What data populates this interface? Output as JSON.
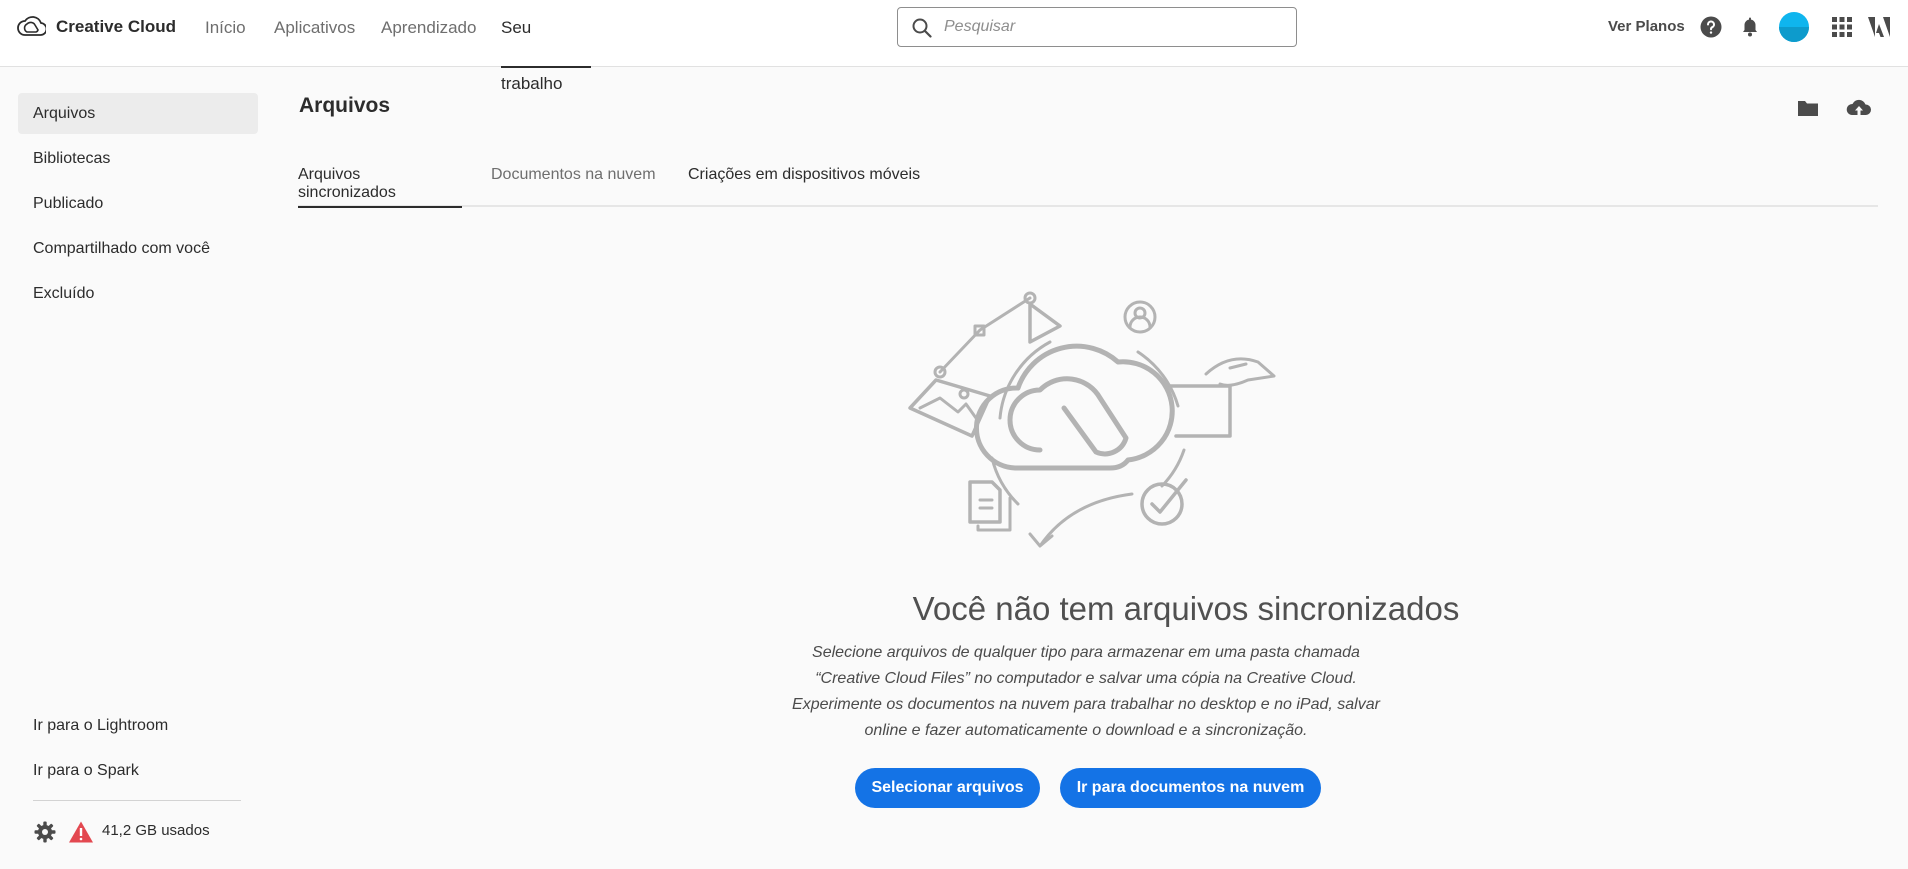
{
  "app": {
    "name": "Creative Cloud"
  },
  "nav": {
    "items": [
      {
        "label": "Início"
      },
      {
        "label": "Aplicativos"
      },
      {
        "label": "Aprendizado"
      },
      {
        "label": "Seu trabalho"
      }
    ],
    "active": "Seu trabalho"
  },
  "search": {
    "placeholder": "Pesquisar",
    "value": ""
  },
  "header_right": {
    "plans_label": "Ver Planos",
    "icons": [
      "help-icon",
      "bell-icon",
      "avatar",
      "apps-grid-icon",
      "adobe-logo-icon"
    ]
  },
  "sidebar": {
    "items": [
      {
        "label": "Arquivos"
      },
      {
        "label": "Bibliotecas"
      },
      {
        "label": "Publicado"
      },
      {
        "label": "Compartilhado com você"
      },
      {
        "label": "Excluído"
      }
    ],
    "active": "Arquivos",
    "links": [
      {
        "label": "Ir para o Lightroom"
      },
      {
        "label": "Ir para o Spark"
      }
    ],
    "storage": {
      "text": "41,2 GB usados",
      "status_icon": "warning-icon"
    }
  },
  "main": {
    "title": "Arquivos",
    "actions": [
      "folder-icon",
      "cloud-upload-icon"
    ],
    "tabs": [
      {
        "label": "Arquivos sincronizados"
      },
      {
        "label": "Documentos na nuvem"
      },
      {
        "label": "Criações em dispositivos móveis"
      }
    ],
    "active_tab": "Arquivos sincronizados",
    "empty_state": {
      "title": "Você não tem arquivos sincronizados",
      "description": "Selecione arquivos de qualquer tipo para armazenar em uma pasta chamada “Creative Cloud Files” no computador e salvar uma cópia na Creative Cloud. Experimente os documentos na nuvem para trabalhar no desktop e no iPad, salvar online e fazer automaticamente o download e a sincronização.",
      "primary_button": "Selecionar arquivos",
      "secondary_button": "Ir para documentos na nuvem"
    }
  },
  "colors": {
    "accent": "#1473e6",
    "warning": "#e34850",
    "avatar": "#0fb5ee"
  }
}
